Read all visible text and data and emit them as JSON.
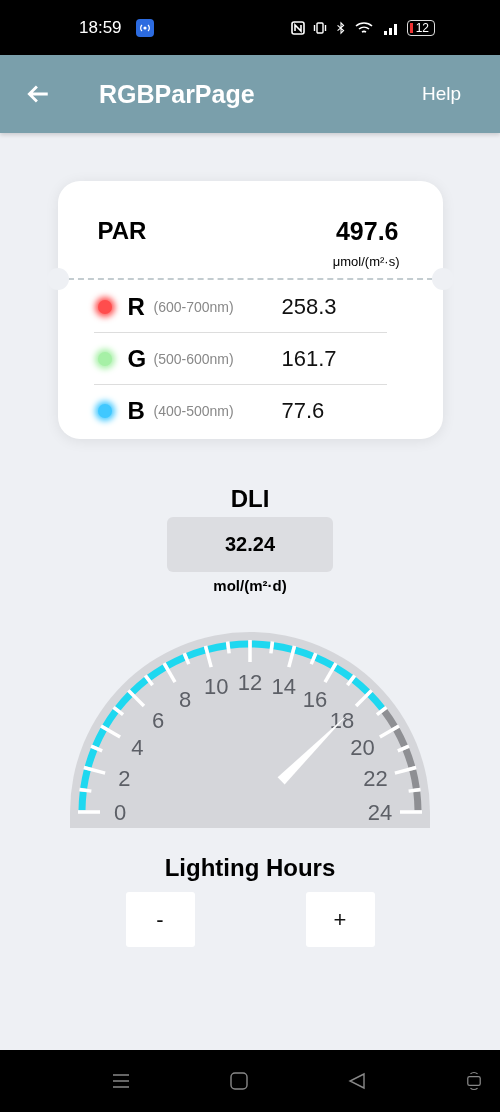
{
  "status_bar": {
    "time": "18:59",
    "battery": "12"
  },
  "app_bar": {
    "title": "RGBParPage",
    "action": "Help"
  },
  "par": {
    "label": "PAR",
    "value": "497.6",
    "unit": "μmol/(m²·s)"
  },
  "channels": [
    {
      "letter": "R",
      "range": "(600-700nm)",
      "value": "258.3",
      "color": "#ff4d4d"
    },
    {
      "letter": "G",
      "range": "(500-600nm)",
      "value": "161.7",
      "color": "#a6f0a6"
    },
    {
      "letter": "B",
      "range": "(400-500nm)",
      "value": "77.6",
      "color": "#40c8ff"
    }
  ],
  "dli": {
    "label": "DLI",
    "value": "32.24",
    "unit": "mol/(m²·d)"
  },
  "gauge": {
    "scale_labels": [
      "0",
      "2",
      "4",
      "6",
      "8",
      "10",
      "12",
      "14",
      "16",
      "18",
      "20",
      "22",
      "24"
    ]
  },
  "lighting_hours": {
    "label": "Lighting Hours",
    "buttons": [
      "-",
      "+"
    ]
  }
}
